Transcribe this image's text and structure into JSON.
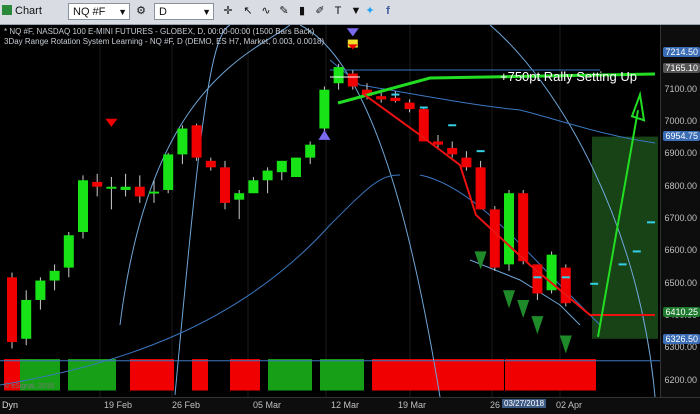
{
  "toolbar": {
    "chart_label": "Chart",
    "symbol": "NQ #F",
    "interval": "D",
    "icons": [
      "gear-icon",
      "crosshair-icon",
      "cursor-icon",
      "line-icon",
      "drawing-icon",
      "bar-icon",
      "draw-tool-icon",
      "text-icon",
      "zoom-icon",
      "settings-icon",
      "arrow-down-icon",
      "twitter-icon",
      "facebook-icon"
    ]
  },
  "header": {
    "line1": "* NQ #F, NASDAQ 100 E-MINI FUTURES - GLOBEX, D, 00:00-00:00 (1500 Bars Back)",
    "line2": "3Day Range Rotation System Learning - NQ #F, D (DEMO, ES H7, Market, 0.003, 0.0018)"
  },
  "annotation": "+750pt Rally Setting Up",
  "copyright": "© eSignal, 2018",
  "axis": {
    "dyn_label": "Dyn",
    "x_labels": [
      "19 Feb",
      "26 Feb",
      "05 Mar",
      "12 Mar",
      "19 Mar",
      "26",
      "02 Apr"
    ],
    "x_highlight": "03/27/2018",
    "y_labels": [
      "7100.00",
      "7000.00",
      "6900.00",
      "6800.00",
      "6700.00",
      "6600.00",
      "6500.00",
      "6400.00",
      "6300.00",
      "6200.00"
    ],
    "price_tags": [
      {
        "value": "7214.50",
        "color": "#3a6db5"
      },
      {
        "value": "7165.10",
        "color": "#555555"
      },
      {
        "value": "6954.75",
        "color": "#3a6db5"
      },
      {
        "value": "6410.25",
        "color": "#1e7a2e"
      },
      {
        "value": "6326.50",
        "color": "#3a6db5"
      }
    ]
  },
  "colors": {
    "up": "#17e317",
    "down": "#f00000",
    "band": "#6fa6d8",
    "panel_bg": "#000000",
    "trend_up": "#22dd22",
    "trend_down": "#ee1111"
  },
  "chart_data": {
    "type": "candlestick",
    "ylim": [
      6150,
      7300
    ],
    "candles": [
      {
        "o": 6520,
        "h": 6535,
        "l": 6300,
        "c": 6320
      },
      {
        "o": 6330,
        "h": 6480,
        "l": 6310,
        "c": 6450
      },
      {
        "o": 6450,
        "h": 6520,
        "l": 6420,
        "c": 6510
      },
      {
        "o": 6510,
        "h": 6560,
        "l": 6480,
        "c": 6540
      },
      {
        "o": 6550,
        "h": 6660,
        "l": 6520,
        "c": 6650
      },
      {
        "o": 6660,
        "h": 6835,
        "l": 6640,
        "c": 6820
      },
      {
        "o": 6815,
        "h": 6840,
        "l": 6770,
        "c": 6800
      },
      {
        "o": 6800,
        "h": 6830,
        "l": 6730,
        "c": 6800
      },
      {
        "o": 6790,
        "h": 6840,
        "l": 6770,
        "c": 6800
      },
      {
        "o": 6800,
        "h": 6835,
        "l": 6750,
        "c": 6770
      },
      {
        "o": 6780,
        "h": 6820,
        "l": 6750,
        "c": 6785
      },
      {
        "o": 6790,
        "h": 6905,
        "l": 6780,
        "c": 6900
      },
      {
        "o": 6900,
        "h": 6990,
        "l": 6870,
        "c": 6980
      },
      {
        "o": 6990,
        "h": 6995,
        "l": 6880,
        "c": 6890
      },
      {
        "o": 6880,
        "h": 6890,
        "l": 6850,
        "c": 6860
      },
      {
        "o": 6860,
        "h": 6880,
        "l": 6730,
        "c": 6750
      },
      {
        "o": 6760,
        "h": 6790,
        "l": 6700,
        "c": 6780
      },
      {
        "o": 6780,
        "h": 6830,
        "l": 6780,
        "c": 6820
      },
      {
        "o": 6820,
        "h": 6860,
        "l": 6780,
        "c": 6850
      },
      {
        "o": 6845,
        "h": 6880,
        "l": 6820,
        "c": 6880
      },
      {
        "o": 6830,
        "h": 6890,
        "l": 6830,
        "c": 6890
      },
      {
        "o": 6890,
        "h": 6940,
        "l": 6870,
        "c": 6930
      },
      {
        "o": 6980,
        "h": 7110,
        "l": 6970,
        "c": 7100
      },
      {
        "o": 7120,
        "h": 7180,
        "l": 7100,
        "c": 7170
      },
      {
        "o": 7150,
        "h": 7160,
        "l": 7100,
        "c": 7110
      },
      {
        "o": 7100,
        "h": 7120,
        "l": 7070,
        "c": 7080
      },
      {
        "o": 7080,
        "h": 7100,
        "l": 7060,
        "c": 7070
      },
      {
        "o": 7075,
        "h": 7095,
        "l": 7060,
        "c": 7065
      },
      {
        "o": 7060,
        "h": 7070,
        "l": 7030,
        "c": 7040
      },
      {
        "o": 7040,
        "h": 7045,
        "l": 6950,
        "c": 6940
      },
      {
        "o": 6940,
        "h": 6960,
        "l": 6920,
        "c": 6930
      },
      {
        "o": 6920,
        "h": 6940,
        "l": 6890,
        "c": 6900
      },
      {
        "o": 6890,
        "h": 6910,
        "l": 6850,
        "c": 6860
      },
      {
        "o": 6860,
        "h": 6880,
        "l": 6730,
        "c": 6730
      },
      {
        "o": 6730,
        "h": 6740,
        "l": 6540,
        "c": 6550
      },
      {
        "o": 6560,
        "h": 6790,
        "l": 6540,
        "c": 6780
      },
      {
        "o": 6780,
        "h": 6790,
        "l": 6560,
        "c": 6570
      },
      {
        "o": 6560,
        "h": 6560,
        "l": 6450,
        "c": 6470
      },
      {
        "o": 6480,
        "h": 6600,
        "l": 6470,
        "c": 6590
      },
      {
        "o": 6550,
        "h": 6560,
        "l": 6430,
        "c": 6440
      }
    ],
    "candle_marks": [
      {
        "i": 7,
        "type": "sell"
      },
      {
        "i": 22,
        "type": "buy"
      },
      {
        "i": 23,
        "type": "sell"
      }
    ]
  }
}
